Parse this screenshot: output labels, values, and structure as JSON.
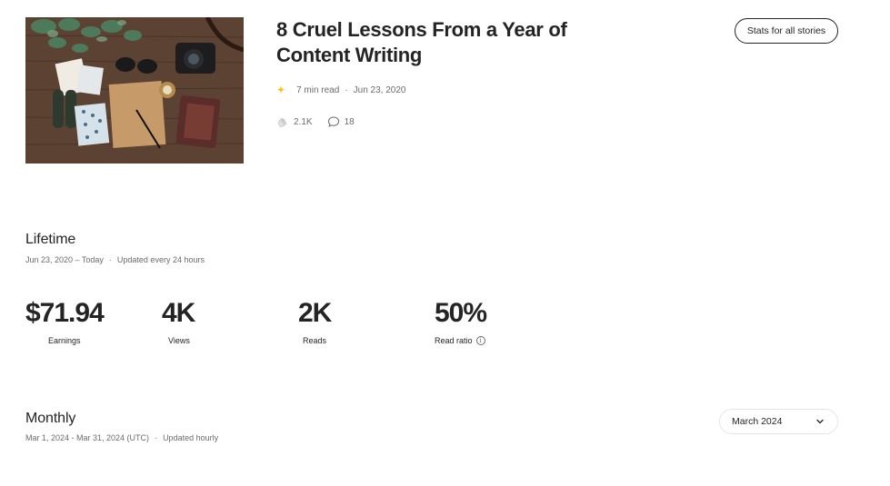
{
  "story": {
    "title": "8 Cruel Lessons From a Year of Content Writing",
    "read_time": "7 min read",
    "date": "Jun 23, 2020",
    "claps": "2.1K",
    "responses": "18",
    "member_icon": "star-icon",
    "thumbnail_icon": "desk-flatlay-image"
  },
  "header": {
    "stats_all_label": "Stats for all stories"
  },
  "lifetime": {
    "title": "Lifetime",
    "range": "Jun 23, 2020 – Today",
    "updated": "Updated every 24 hours",
    "stats": [
      {
        "value": "$71.94",
        "label": "Earnings"
      },
      {
        "value": "4K",
        "label": "Views"
      },
      {
        "value": "2K",
        "label": "Reads"
      },
      {
        "value": "50%",
        "label": "Read ratio"
      }
    ]
  },
  "monthly": {
    "title": "Monthly",
    "range": "Mar 1, 2024 - Mar 31, 2024 (UTC)",
    "updated": "Updated hourly",
    "selected_month": "March 2024"
  },
  "colors": {
    "text": "#242424",
    "muted": "#6b6b6b",
    "member_star": "#ffc017",
    "border": "#e6e6e6"
  }
}
